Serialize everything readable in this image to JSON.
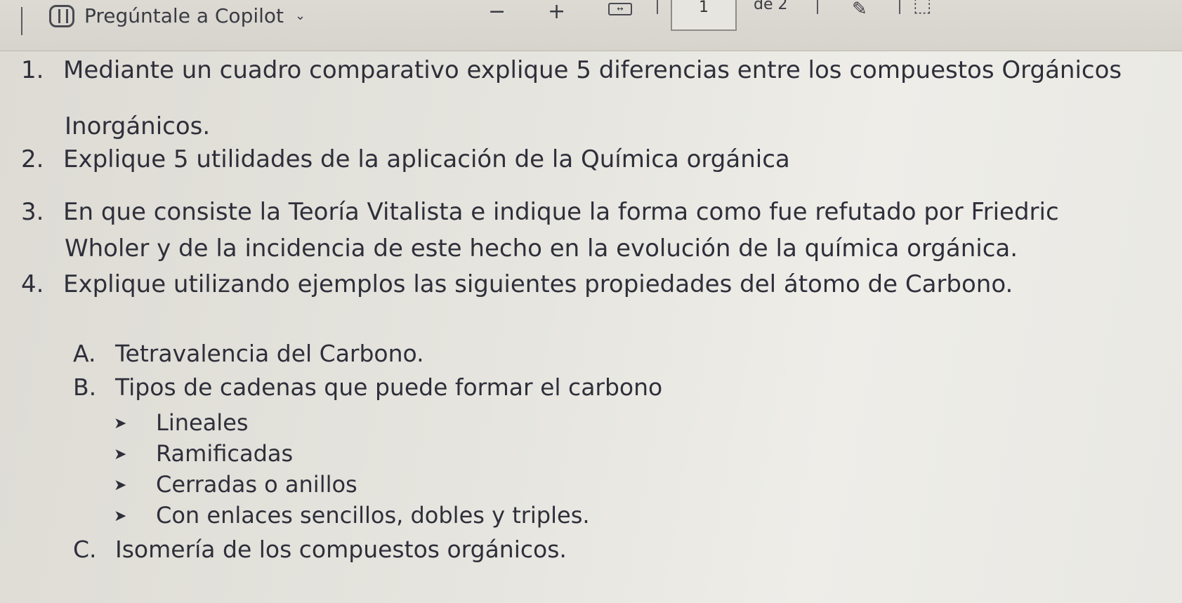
{
  "toolbar": {
    "copilot_label": "Pregúntale a Copilot",
    "zoom_out": "−",
    "zoom_in": "+",
    "page_current": "1",
    "page_total": "de 2"
  },
  "document": {
    "questions": [
      {
        "number": "1.",
        "lines": [
          "Mediante un cuadro comparativo explique 5 diferencias entre los compuestos Orgánicos",
          "Inorgánicos."
        ]
      },
      {
        "number": "2.",
        "lines": [
          "Explique 5 utilidades de la aplicación de la Química orgánica"
        ]
      },
      {
        "number": "3.",
        "lines": [
          "En que consiste la Teoría Vitalista e indique la forma como fue refutado por Friedric",
          "Wholer y de la incidencia de este hecho en la evolución de la química orgánica."
        ]
      },
      {
        "number": "4.",
        "lines": [
          "Explique utilizando ejemplos las siguientes propiedades del átomo de Carbono."
        ]
      }
    ],
    "subitems": [
      {
        "letter": "A.",
        "text": "Tetravalencia del Carbono."
      },
      {
        "letter": "B.",
        "text": "Tipos de cadenas que puede formar el carbono"
      },
      {
        "letter": "C.",
        "text": "Isomería de los compuestos orgánicos."
      }
    ],
    "bullets": [
      "Lineales",
      "Ramificadas",
      "Cerradas o anillos",
      "Con enlaces sencillos, dobles y triples."
    ]
  }
}
